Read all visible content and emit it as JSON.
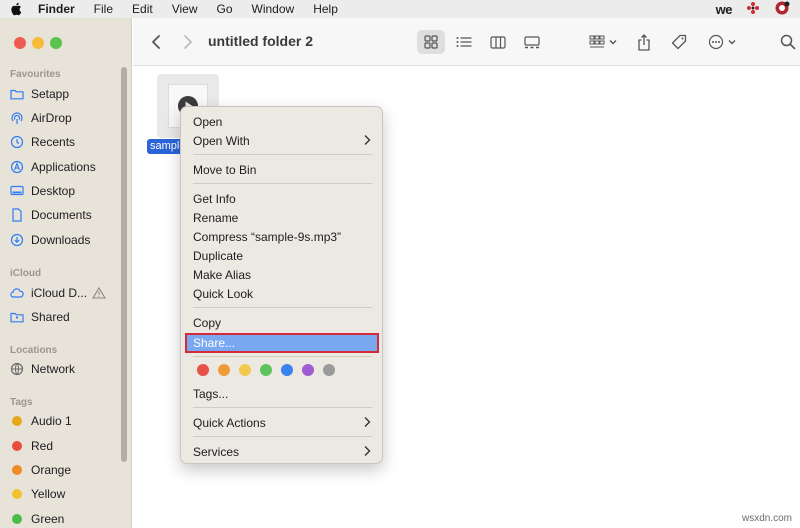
{
  "menubar": {
    "app": "Finder",
    "items": [
      "File",
      "Edit",
      "View",
      "Go",
      "Window",
      "Help"
    ],
    "we_logo": "we"
  },
  "sidebar": {
    "sections": {
      "favourites": "Favourites",
      "icloud": "iCloud",
      "locations": "Locations",
      "tags": "Tags"
    },
    "favourites": [
      "Setapp",
      "AirDrop",
      "Recents",
      "Applications",
      "Desktop",
      "Documents",
      "Downloads"
    ],
    "icloud": [
      "iCloud D...",
      "Shared"
    ],
    "locations": [
      "Network"
    ],
    "tags": [
      {
        "label": "Audio 1",
        "color": "#e6a817"
      },
      {
        "label": "Red",
        "color": "#e84c3d"
      },
      {
        "label": "Orange",
        "color": "#f08a24"
      },
      {
        "label": "Yellow",
        "color": "#f2c12e"
      },
      {
        "label": "Green",
        "color": "#4cbb4a"
      }
    ]
  },
  "toolbar": {
    "title": "untitled folder 2"
  },
  "file": {
    "label": "sample"
  },
  "context_menu": {
    "items": {
      "open": "Open",
      "open_with": "Open With",
      "move_to_bin": "Move to Bin",
      "get_info": "Get Info",
      "rename": "Rename",
      "compress": "Compress “sample-9s.mp3”",
      "duplicate": "Duplicate",
      "make_alias": "Make Alias",
      "quick_look": "Quick Look",
      "copy": "Copy",
      "share": "Share...",
      "tags": "Tags...",
      "quick_actions": "Quick Actions",
      "services": "Services"
    },
    "tag_colors": [
      "#e8514a",
      "#f09a3a",
      "#f2c94c",
      "#5cc45a",
      "#3b82f0",
      "#a15bd0",
      "#9a9a9a"
    ]
  },
  "watermark": "wsxdn.com"
}
